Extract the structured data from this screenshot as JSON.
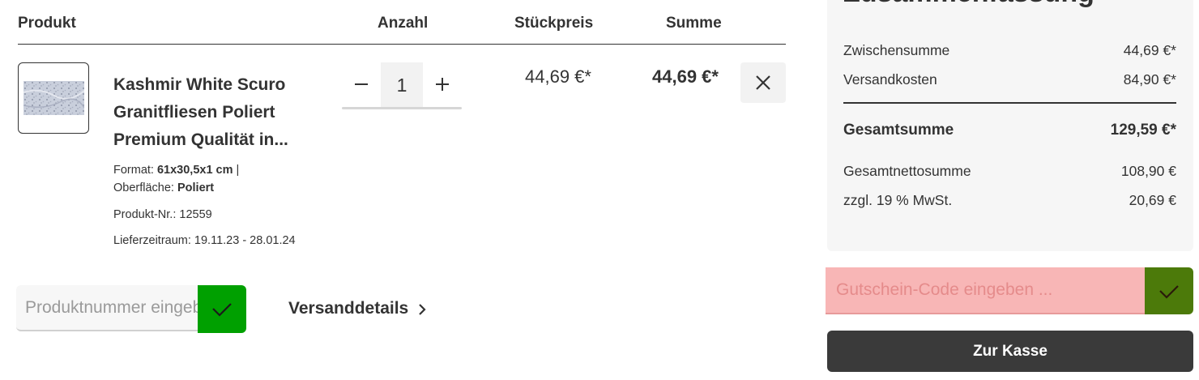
{
  "table": {
    "headers": {
      "product": "Produkt",
      "quantity": "Anzahl",
      "unit_price": "Stückpreis",
      "sum": "Summe"
    }
  },
  "item": {
    "name": "Kashmir White Scuro Granitfliesen Poliert Premium Qualität in...",
    "format_label": "Format:",
    "format_value": "61x30,5x1 cm",
    "format_sep": "|",
    "surface_label": "Oberfläche:",
    "surface_value": "Poliert",
    "product_number": "Produkt-Nr.: 12559",
    "delivery": "Lieferzeitraum: 19.11.23 - 28.01.24",
    "quantity": "1",
    "unit_price": "44,69 €*",
    "total": "44,69 €*",
    "thumbnail_icon": "granite-tile-image"
  },
  "product_number_form": {
    "placeholder": "Produktnummer eingeben ...",
    "submit_icon": "checkmark-icon",
    "submit_color": "#00a000"
  },
  "shipping_link": {
    "label": "Versanddetails",
    "icon": "chevron-right-icon"
  },
  "summary": {
    "title": "Zusammenfassung",
    "rows": {
      "subtotal": {
        "label": "Zwischensumme",
        "value": "44,69 €*"
      },
      "shipping": {
        "label": "Versandkosten",
        "value": "84,90 €*"
      },
      "total": {
        "label": "Gesamtsumme",
        "value": "129,59 €*"
      },
      "net": {
        "label": "Gesamtnettosumme",
        "value": "108,90 €"
      },
      "vat": {
        "label": "zzgl. 19 % MwSt.",
        "value": "20,69 €"
      }
    }
  },
  "voucher": {
    "placeholder": "Gutschein-Code eingeben ...",
    "input_color": "#f8b6b6",
    "submit_color": "#4c7a0a"
  },
  "checkout": {
    "label": "Zur Kasse",
    "color": "#3a3a3a"
  }
}
